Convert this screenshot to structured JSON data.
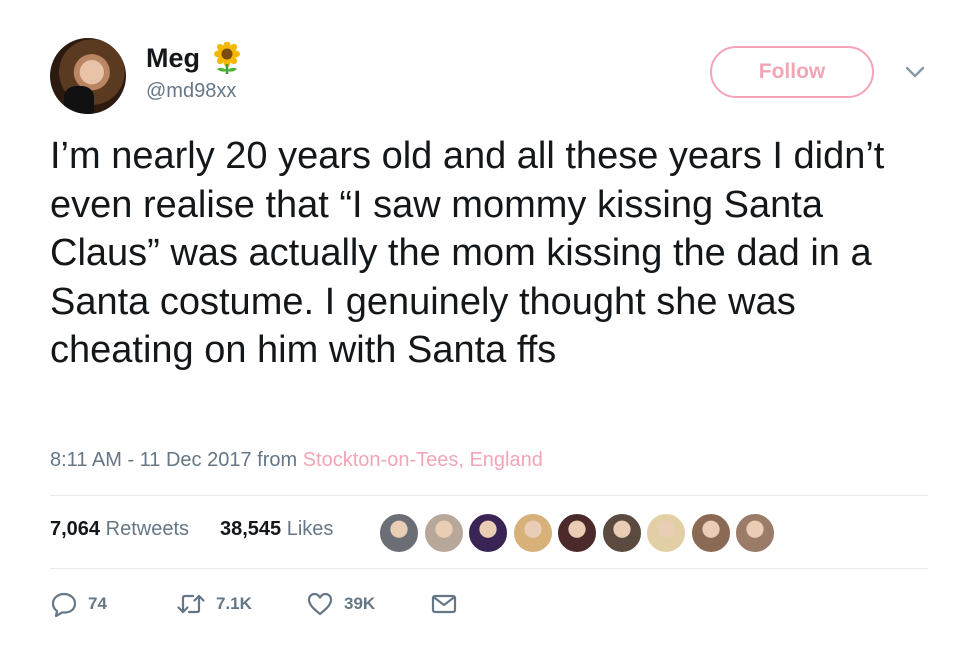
{
  "user": {
    "name": "Meg",
    "handle": "@md98xx",
    "emoji_icon": "sunflower-icon"
  },
  "follow": {
    "label": "Follow"
  },
  "tweet": {
    "text": "I’m nearly 20 years old and all these years I didn’t even realise that “I saw mommy kissing Santa Claus” was actually the mom kissing the dad in a Santa costume. I genuinely thought she was cheating on him with Santa ffs",
    "time": "8:11 AM - 11 Dec 2017 from ",
    "location": "Stockton-on-Tees, England"
  },
  "stats": {
    "retweets_count": "7,064",
    "retweets_label": "Retweets",
    "likes_count": "38,545",
    "likes_label": "Likes"
  },
  "liked_by_faces": [
    "#6b6e74",
    "#b8a89a",
    "#3a2456",
    "#d7b07a",
    "#4a2a2a",
    "#5a4a40",
    "#e3cfa6",
    "#8b6a55",
    "#9a7c68"
  ],
  "actions": {
    "reply_count": "74",
    "retweet_count": "7.1K",
    "like_count": "39K"
  },
  "colors": {
    "accent_pink": "#f3a5b6",
    "secondary_text": "#657786",
    "primary_text": "#14171a",
    "divider": "#e6ecf0"
  }
}
